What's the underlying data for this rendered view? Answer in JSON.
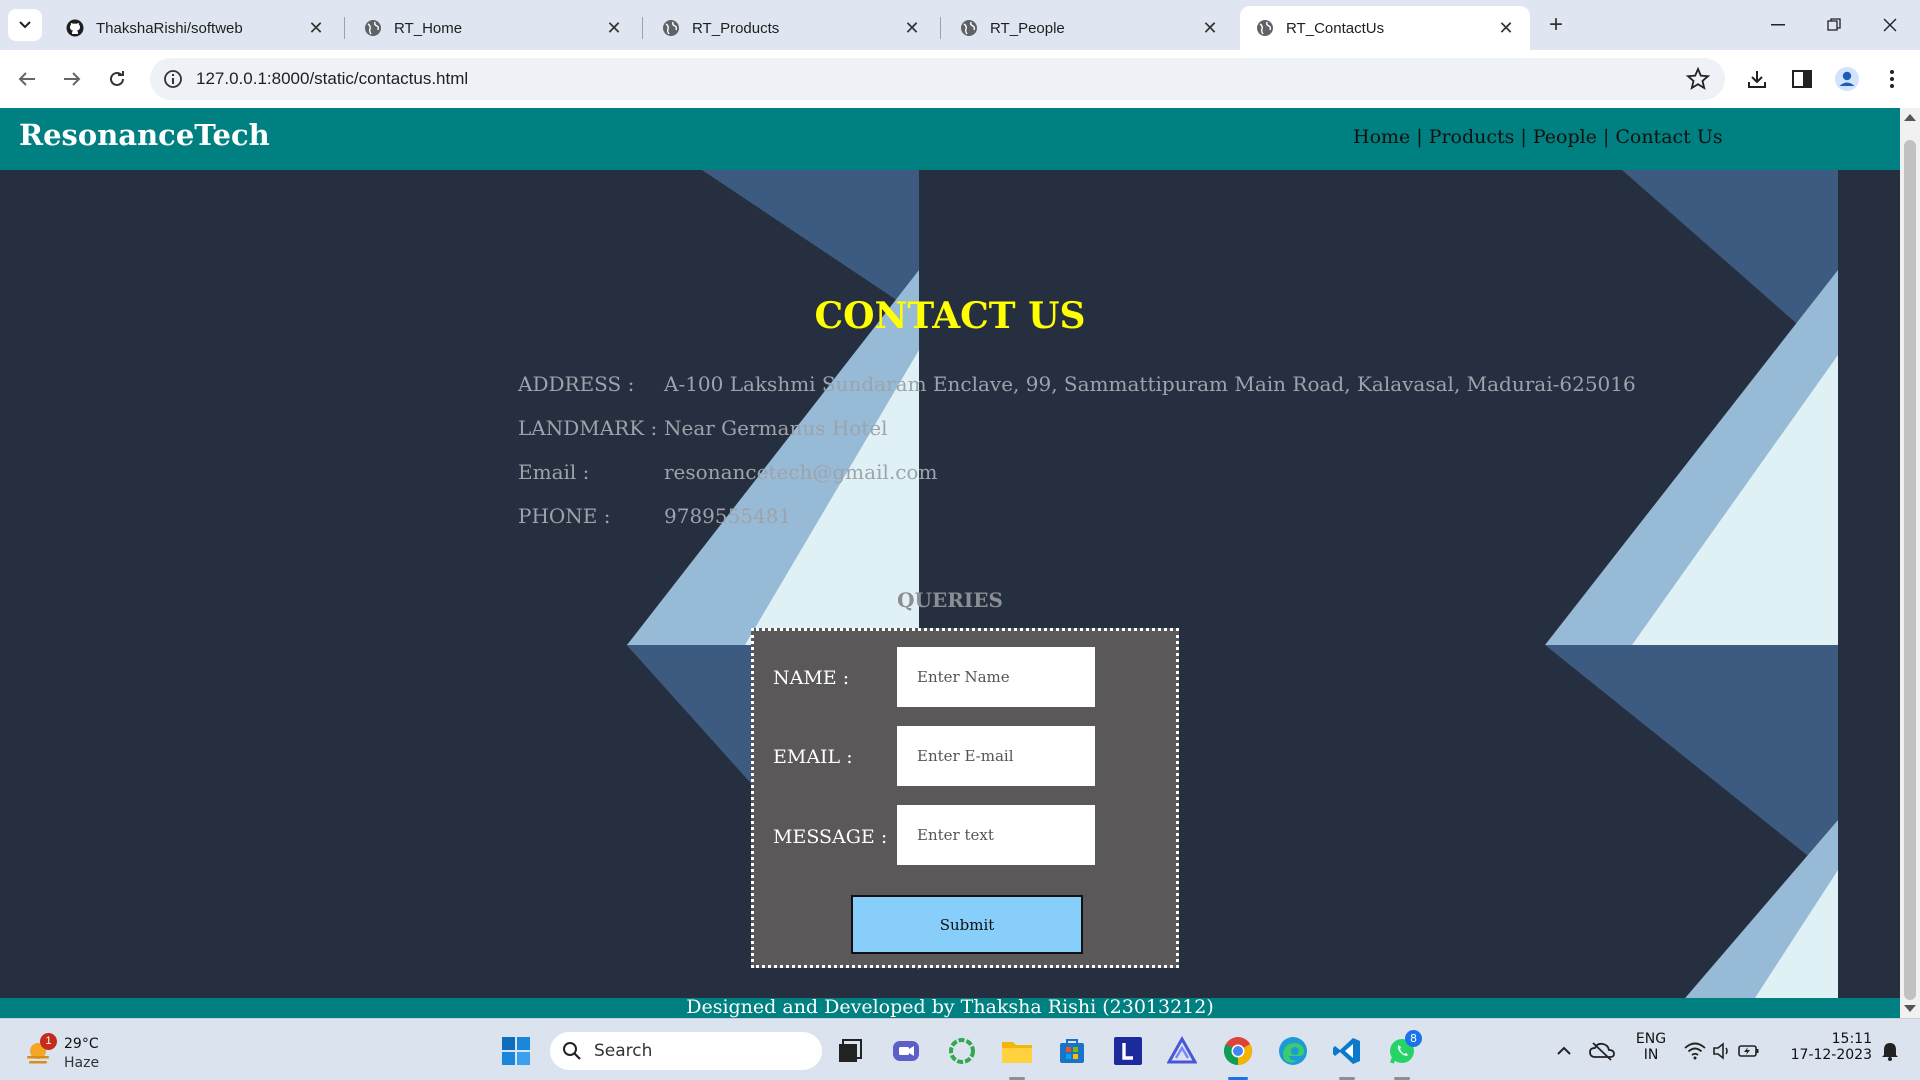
{
  "browser": {
    "tabs": [
      {
        "title": "ThakshaRishi/softweb",
        "icon": "github-icon",
        "active": false
      },
      {
        "title": "RT_Home",
        "icon": "globe-icon",
        "active": false
      },
      {
        "title": "RT_Products",
        "icon": "globe-icon",
        "active": false
      },
      {
        "title": "RT_People",
        "icon": "globe-icon",
        "active": false
      },
      {
        "title": "RT_ContactUs",
        "icon": "globe-icon",
        "active": true
      }
    ],
    "new_tab_label": "+",
    "url": "127.0.0.1:8000/static/contactus.html"
  },
  "site": {
    "brand": "ResonanceTech",
    "nav": [
      {
        "label": "Home"
      },
      {
        "label": "Products"
      },
      {
        "label": "People"
      },
      {
        "label": "Contact Us"
      }
    ],
    "nav_separator": "|",
    "title": "CONTACT US",
    "info": [
      {
        "label": "ADDRESS :",
        "value": "A-100 Lakshmi Sundaram Enclave, 99, Sammattipuram Main Road, Kalavasal, Madurai-625016"
      },
      {
        "label": "LANDMARK :",
        "value": "Near Germanus Hotel"
      },
      {
        "label": "Email :",
        "value": "resonancetech@gmail.com"
      },
      {
        "label": "PHONE :",
        "value": "9789555481"
      }
    ],
    "queries_title": "QUERIES",
    "form": {
      "name_label": "NAME :",
      "name_placeholder": "Enter Name",
      "email_label": "EMAIL :",
      "email_placeholder": "Enter E-mail",
      "message_label": "MESSAGE :",
      "message_placeholder": "Enter text",
      "submit_label": "Submit"
    },
    "footer": "Designed and Developed by Thaksha Rishi (23013212)"
  },
  "colors": {
    "header_bg": "#008080",
    "page_bg": "#262f3f",
    "title": "#ffff00",
    "form_bg": "#5a5858",
    "submit_bg": "#87cefa"
  },
  "taskbar": {
    "weather_temp": "29°C",
    "weather_cond": "Haze",
    "weather_badge": "1",
    "search_label": "Search",
    "whatsapp_badge": "8",
    "language_line1": "ENG",
    "language_line2": "IN",
    "time": "15:11",
    "date": "17-12-2023"
  }
}
